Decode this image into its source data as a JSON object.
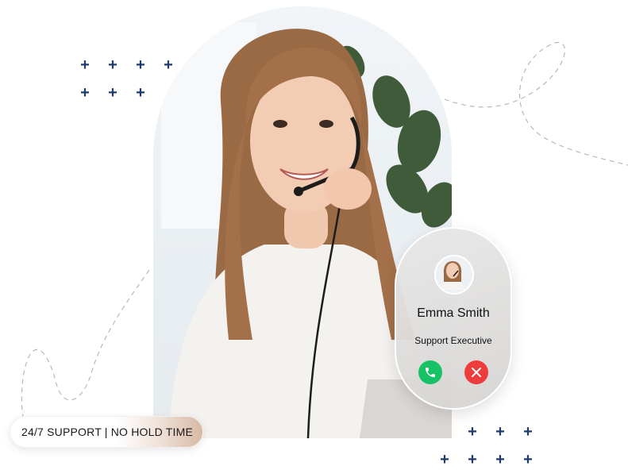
{
  "call_card": {
    "name": "Emma Smith",
    "role": "Support Executive",
    "accept_icon": "phone-icon",
    "decline_icon": "close-icon"
  },
  "badge": {
    "text": "24/7 SUPPORT | NO HOLD TIME"
  },
  "colors": {
    "accept": "#16c265",
    "decline": "#ee3b3b",
    "plus": "#1f3b6e"
  }
}
